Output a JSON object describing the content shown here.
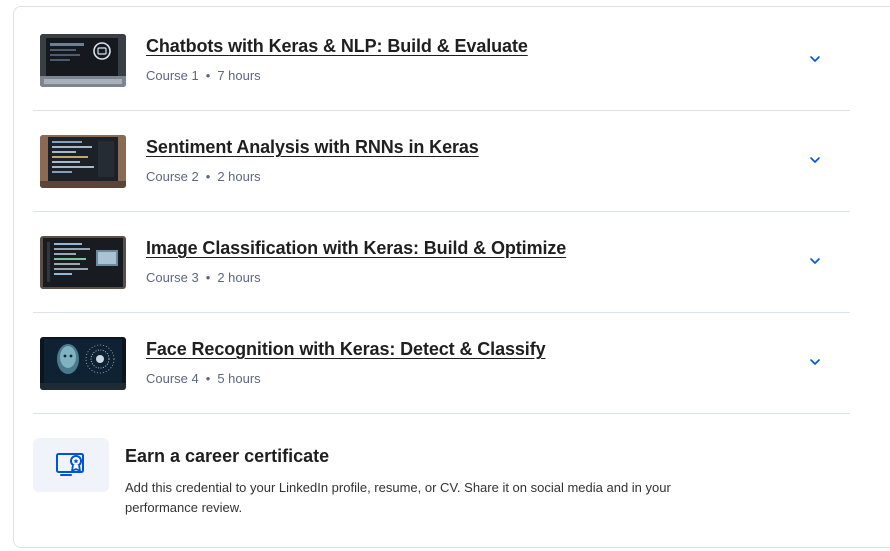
{
  "courses": [
    {
      "title": "Chatbots with Keras & NLP: Build & Evaluate",
      "course_label": "Course 1",
      "duration": "7 hours",
      "thumbnail": "laptop-chat-icon-thumbnail"
    },
    {
      "title": "Sentiment Analysis with RNNs in Keras",
      "course_label": "Course 2",
      "duration": "2 hours",
      "thumbnail": "laptop-code-thumbnail"
    },
    {
      "title": "Image Classification with Keras: Build & Optimize",
      "course_label": "Course 3",
      "duration": "2 hours",
      "thumbnail": "monitor-code-thumbnail"
    },
    {
      "title": "Face Recognition with Keras: Detect & Classify",
      "course_label": "Course 4",
      "duration": "5 hours",
      "thumbnail": "face-scan-thumbnail"
    }
  ],
  "meta_separator": "•",
  "chevron_icon": "chevron-down-icon",
  "certificate": {
    "title": "Earn a career certificate",
    "description": "Add this credential to your LinkedIn profile, resume, or CV. Share it on social media and in your performance review.",
    "icon": "certificate-icon"
  },
  "colors": {
    "accent": "#0056d2",
    "border": "#dde2e8",
    "meta_text": "#5b6780",
    "icon_bg": "#f0f4fa"
  }
}
